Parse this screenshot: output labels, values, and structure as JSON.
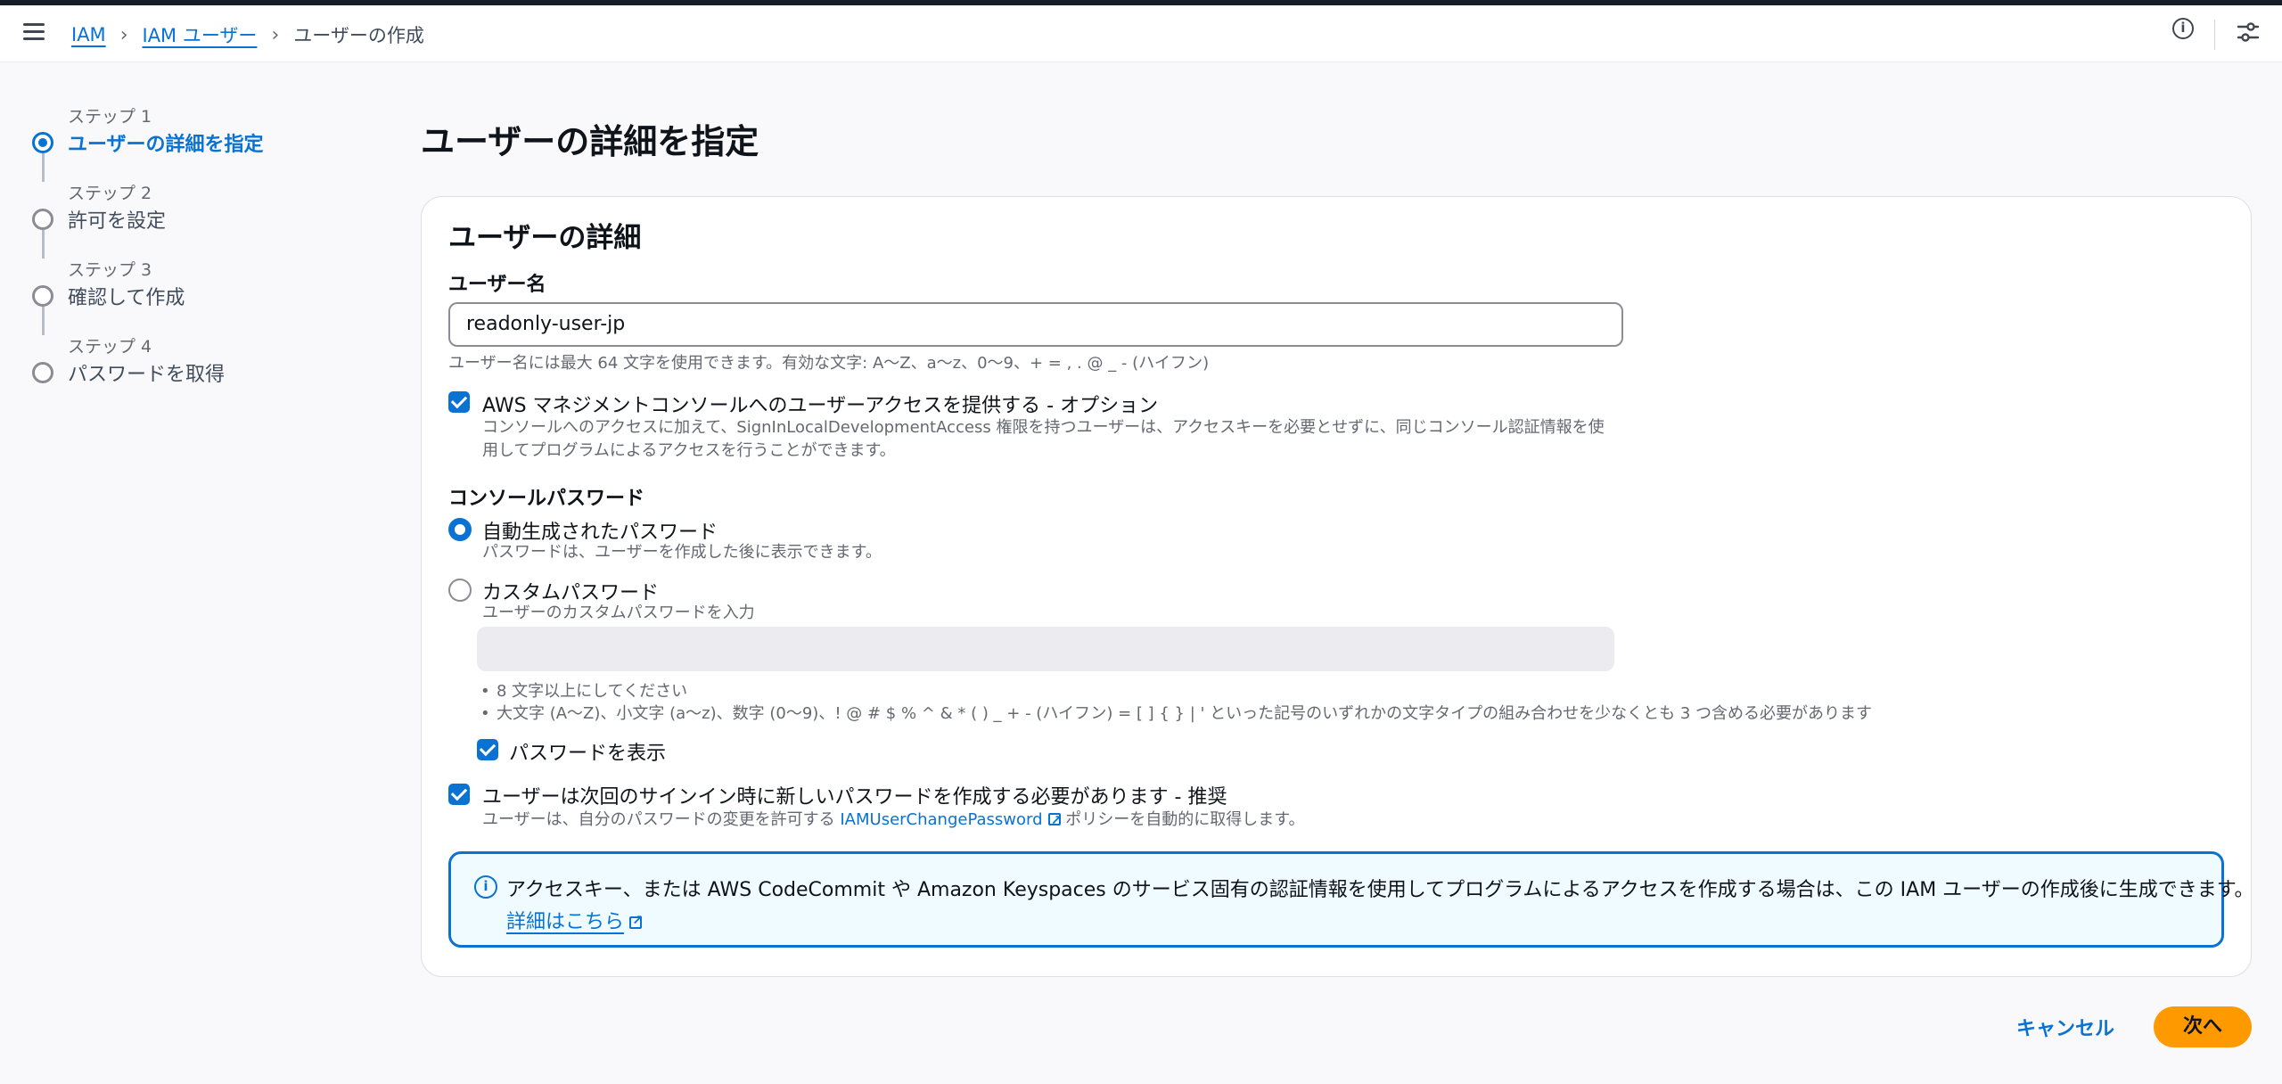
{
  "breadcrumb": {
    "items": [
      "IAM",
      "IAM ユーザー"
    ],
    "current": "ユーザーの作成"
  },
  "icons": {
    "menu": "hamburger-menu-icon",
    "info": "info-icon",
    "settings": "settings-icon",
    "external": "external-link-icon"
  },
  "steps": [
    {
      "num": "ステップ 1",
      "title": "ユーザーの詳細を指定",
      "active": true
    },
    {
      "num": "ステップ 2",
      "title": "許可を設定",
      "active": false
    },
    {
      "num": "ステップ 3",
      "title": "確認して作成",
      "active": false
    },
    {
      "num": "ステップ 4",
      "title": "パスワードを取得",
      "active": false
    }
  ],
  "page": {
    "title": "ユーザーの詳細を指定"
  },
  "details": {
    "title": "ユーザーの詳細",
    "username_label": "ユーザー名",
    "username_value": "readonly-user-jp",
    "username_hint": "ユーザー名には最大 64 文字を使用できます。有効な文字: A〜Z、a〜z、0〜9、+ = , . @ _ - (ハイフン)",
    "console_access_label": "AWS マネジメントコンソールへのユーザーアクセスを提供する - オプション",
    "console_access_checked": true,
    "console_access_desc_1": "コンソールへのアクセスに加えて、SignInLocalDevelopmentAccess 権限を持つユーザーは、アクセスキーを必要とせずに、同じコンソール認証情報を使",
    "console_access_desc_2": "用してプログラムによるアクセスを行うことができます。",
    "console_password_label": "コンソールパスワード",
    "auto_pw_label": "自動生成されたパスワード",
    "auto_pw_desc": "パスワードは、ユーザーを作成した後に表示できます。",
    "auto_pw_selected": true,
    "custom_pw_label": "カスタムパスワード",
    "custom_pw_desc": "ユーザーのカスタムパスワードを入力",
    "pw_rule_1": "8 文字以上にしてください",
    "pw_rule_2": "大文字 (A〜Z)、小文字 (a〜z)、数字 (0〜9)、! @ # $ % ^ & * ( ) _ + - (ハイフン) = [ ] { } | ' といった記号のいずれかの文字タイプの組み合わせを少なくとも 3 つ含める必要があります",
    "show_pw_label": "パスワードを表示",
    "show_pw_checked": true,
    "reset_label": "ユーザーは次回のサインイン時に新しいパスワードを作成する必要があります - 推奨",
    "reset_checked": true,
    "reset_desc_prefix": "ユーザーは、自分のパスワードの変更を許可する",
    "reset_desc_link": "IAMUserChangePassword",
    "reset_desc_suffix": "ポリシーを自動的に取得します。"
  },
  "alert": {
    "text": "アクセスキー、または AWS CodeCommit や Amazon Keyspaces のサービス固有の認証情報を使用してプログラムによるアクセスを作成する場合は、この IAM ユーザーの作成後に生成できます。",
    "link": "詳細はこちら"
  },
  "footer": {
    "cancel": "キャンセル",
    "next": "次へ"
  },
  "colors": {
    "accent": "#0972d3",
    "primary_button": "#ff9900"
  }
}
